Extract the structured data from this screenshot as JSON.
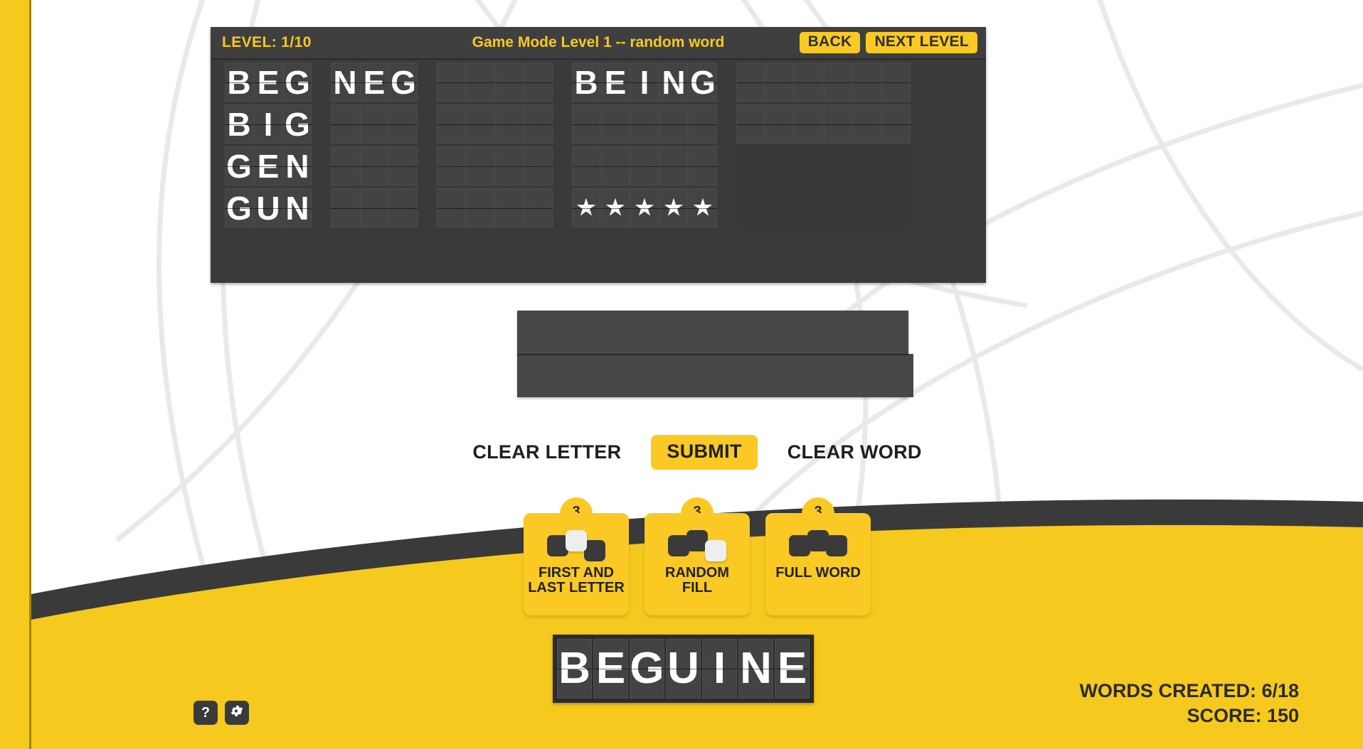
{
  "header": {
    "level_label": "LEVEL: 1/10",
    "title": "Game Mode Level 1 -- random word",
    "back_label": "BACK",
    "next_level_label": "NEXT LEVEL"
  },
  "grid": {
    "group_sizes": [
      3,
      3,
      4,
      5,
      6
    ],
    "rows": [
      {
        "groups": [
          [
            "B",
            "E",
            "G"
          ],
          [
            "N",
            "E",
            "G"
          ],
          [
            "",
            "",
            "",
            ""
          ],
          [
            "B",
            "E",
            "I",
            "N",
            "G"
          ],
          [
            "",
            "",
            "",
            "",
            "",
            ""
          ]
        ]
      },
      {
        "groups": [
          [
            "B",
            "I",
            "G"
          ],
          [
            "",
            "",
            ""
          ],
          [
            "",
            "",
            "",
            ""
          ],
          [
            "",
            "",
            "",
            "",
            ""
          ],
          [
            "",
            "",
            "",
            "",
            "",
            ""
          ]
        ]
      },
      {
        "groups": [
          [
            "G",
            "E",
            "N"
          ],
          [
            "",
            "",
            ""
          ],
          [
            "",
            "",
            "",
            ""
          ],
          [
            "",
            "",
            "",
            "",
            ""
          ],
          null
        ]
      },
      {
        "groups": [
          [
            "G",
            "U",
            "N"
          ],
          [
            "",
            "",
            ""
          ],
          [
            "",
            "",
            "",
            ""
          ],
          [
            "★",
            "★",
            "★",
            "★",
            "★"
          ],
          null
        ]
      }
    ]
  },
  "input_panel": {
    "value": ""
  },
  "actions": {
    "clear_letter": "CLEAR LETTER",
    "submit": "SUBMIT",
    "clear_word": "CLEAR WORD"
  },
  "powerups": [
    {
      "count": "3",
      "label": "FIRST AND LAST LETTER",
      "icon": "first-last-letter-icon",
      "tiles": [
        "d",
        "l",
        "d"
      ]
    },
    {
      "count": "3",
      "label": "RANDOM FILL",
      "icon": "random-fill-icon",
      "tiles": [
        "d",
        "d",
        "l"
      ]
    },
    {
      "count": "3",
      "label": "FULL WORD",
      "icon": "full-word-icon",
      "tiles": [
        "d",
        "d",
        "d"
      ]
    }
  ],
  "word_display": {
    "letters": [
      "B",
      "E",
      "G",
      "U",
      "I",
      "N",
      "E"
    ]
  },
  "stats": {
    "words_created": "WORDS CREATED: 6/18",
    "score": "SCORE: 150"
  },
  "corner_buttons": {
    "help": "?",
    "settings": "gear-icon"
  },
  "colors": {
    "brand_yellow": "#F6C91F",
    "button_yellow": "#FBC924",
    "dark": "#3a3a3a",
    "panel": "#434343"
  }
}
